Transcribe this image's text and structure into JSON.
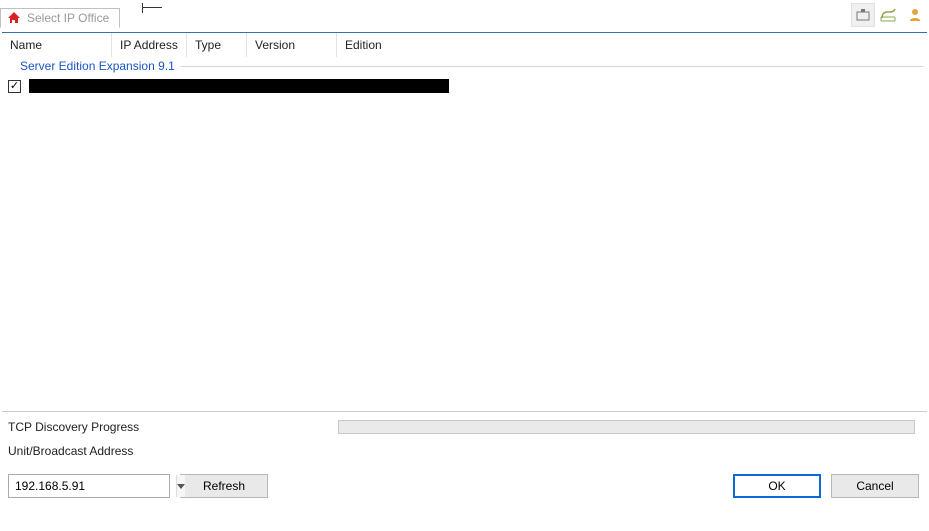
{
  "tab": {
    "label": "Select IP Office"
  },
  "columns": {
    "name": "Name",
    "ip": "IP Address",
    "type": "Type",
    "version": "Version",
    "edition": "Edition"
  },
  "group": {
    "label": "Server Edition Expansion 9.1"
  },
  "items": [
    {
      "checked": true
    }
  ],
  "bottom": {
    "progress_label": "TCP Discovery Progress",
    "broadcast_label": "Unit/Broadcast Address",
    "broadcast_value": "192.168.5.91",
    "refresh": "Refresh",
    "ok": "OK",
    "cancel": "Cancel"
  }
}
